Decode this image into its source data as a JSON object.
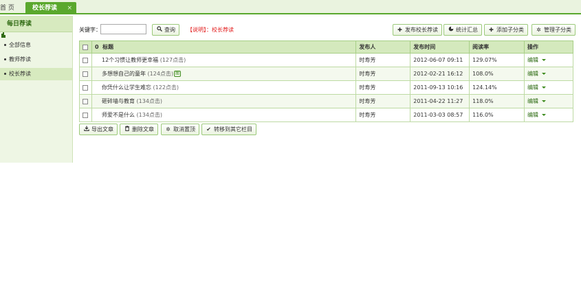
{
  "tabs": {
    "home": "首 页",
    "active": "校长荐读",
    "close": "×"
  },
  "sidebar": {
    "title": "每日荐读",
    "items": [
      {
        "label": "全部信息"
      },
      {
        "label": "教师荐读"
      },
      {
        "label": "校长荐读"
      }
    ]
  },
  "toolbar": {
    "keyword_label": "关键字：",
    "keyword_value": "",
    "search_label": "查询",
    "note": "【说明】：校长荐读",
    "publish_label": "发布校长荐读",
    "stats_label": "统计汇总",
    "add_sub_label": "添加子分类",
    "manage_sub_label": "管理子分类"
  },
  "table": {
    "headers": {
      "zero": "0",
      "title": "标题",
      "publisher": "发布人",
      "time": "发布时间",
      "rate": "阅读率",
      "action": "操作"
    },
    "rows": [
      {
        "title": "12个习惯让教师更幸福",
        "clicks": "(127点击)",
        "badge": "",
        "publisher": "时寿芳",
        "time": "2012-06-07 09:11",
        "rate": "129.07%",
        "action": "编辑"
      },
      {
        "title": "多想想自己的童年",
        "clicks": "(124点击)",
        "badge": "图",
        "publisher": "时寿芳",
        "time": "2012-02-21 16:12",
        "rate": "108.0%",
        "action": "编辑"
      },
      {
        "title": "你凭什么让学生难忘",
        "clicks": "(122点击)",
        "badge": "",
        "publisher": "时寿芳",
        "time": "2011-09-13 10:16",
        "rate": "124.14%",
        "action": "编辑"
      },
      {
        "title": "砸碎墙与教育",
        "clicks": "(134点击)",
        "badge": "",
        "publisher": "时寿芳",
        "time": "2011-04-22 11:27",
        "rate": "118.0%",
        "action": "编辑"
      },
      {
        "title": "师爱不是什么",
        "clicks": "(134点击)",
        "badge": "",
        "publisher": "时寿芳",
        "time": "2011-03-03 08:57",
        "rate": "116.0%",
        "action": "编辑"
      }
    ]
  },
  "actions": {
    "export_label": "导出文章",
    "delete_label": "删除文章",
    "untop_label": "取消置顶",
    "move_label": "转移到其它栏目"
  },
  "colors": {
    "accent": "#5aa82d",
    "header_bg": "#d4e9bd",
    "note_red": "#e21a1a"
  }
}
